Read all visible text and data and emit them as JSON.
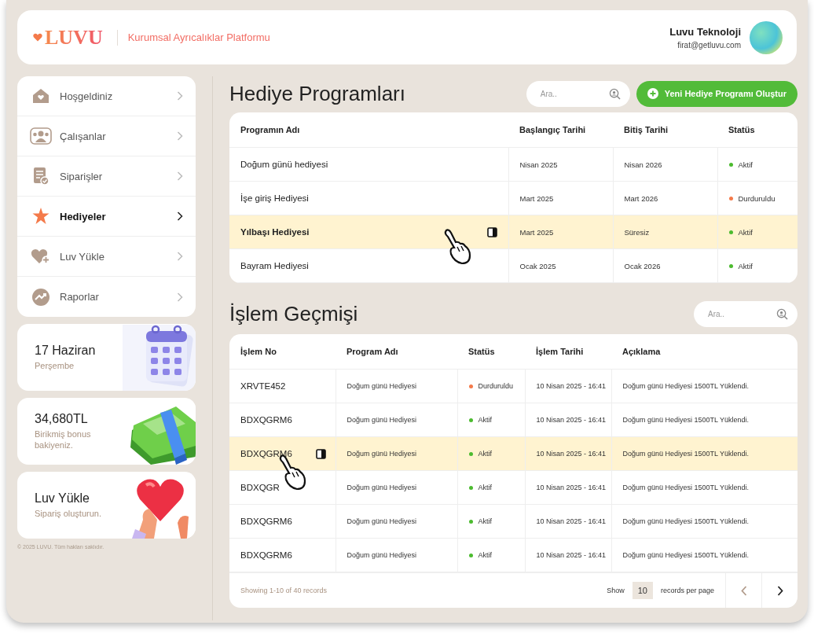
{
  "header": {
    "logo": "LUVU",
    "tagline": "Kurumsal Ayrıcalıklar Platformu",
    "company": "Luvu Teknoloji",
    "email": "firat@getluvu.com"
  },
  "sidebar": {
    "items": [
      {
        "label": "Hoşgeldiniz",
        "selected": false
      },
      {
        "label": "Çalışanlar",
        "selected": false
      },
      {
        "label": "Siparişler",
        "selected": false
      },
      {
        "label": "Hediyeler",
        "selected": true
      },
      {
        "label": "Luv Yükle",
        "selected": false
      },
      {
        "label": "Raporlar",
        "selected": false
      }
    ]
  },
  "cards": [
    {
      "kind": "calendar",
      "title": "17 Haziran",
      "subtitle": "Perşembe"
    },
    {
      "kind": "money",
      "title": "34,680TL",
      "subtitle": "Birikmiş bonus bakiyeniz."
    },
    {
      "kind": "heart",
      "title": "Luv Yükle",
      "subtitle": "Sipariş oluşturun."
    }
  ],
  "footer": "© 2025 LUVU. Tüm hakları saklıdır.",
  "programs": {
    "title": "Hediye Programları",
    "search": {
      "placeholder": "Ara.."
    },
    "create_button": "Yeni Hediye Programı Oluştur",
    "columns": [
      "Programın Adı",
      "Başlangıç Tarihi",
      "Bitiş Tarihi",
      "Statüs"
    ],
    "rows": [
      {
        "selected": false,
        "cells": [
          {
            "text": "Doğum günü hediyesi"
          },
          {
            "text": "Nisan 2025"
          },
          {
            "text": "Nisan 2026"
          },
          {
            "text": "Aktif",
            "color": "#4cbb2f"
          }
        ]
      },
      {
        "selected": false,
        "cells": [
          {
            "text": "İşe giriş Hediyesi"
          },
          {
            "text": "Mart 2025"
          },
          {
            "text": "Mart 2026"
          },
          {
            "text": "Durduruldu",
            "color": "#f47a4a"
          }
        ]
      },
      {
        "selected": true,
        "cells": [
          {
            "text": "Yılbaşı Hediyesi"
          },
          {
            "text": "Mart 2025"
          },
          {
            "text": "Süresiz"
          },
          {
            "text": "Aktif",
            "color": "#4cbb2f"
          }
        ]
      },
      {
        "selected": false,
        "cells": [
          {
            "text": "Bayram Hediyesi"
          },
          {
            "text": "Ocak 2025"
          },
          {
            "text": "Ocak 2026"
          },
          {
            "text": "Aktif",
            "color": "#4cbb2f"
          }
        ]
      }
    ]
  },
  "history": {
    "title": "İşlem Geçmişi",
    "search": {
      "placeholder": "Ara.."
    },
    "columns": [
      "İşlem No",
      "Program Adı",
      "Statüs",
      "İşlem Tarihi",
      "Açıklama"
    ],
    "rows": [
      {
        "selected": false,
        "cells": [
          {
            "text": "XRVTE452"
          },
          {
            "text": "Doğum günü Hediyesi"
          },
          {
            "text": "Durduruldu",
            "color": "#f47a4a"
          },
          {
            "text": "10 Nisan 2025 - 16:41"
          },
          {
            "text": "Doğum günü Hediyesi 1500TL Yüklendi."
          }
        ]
      },
      {
        "selected": false,
        "cells": [
          {
            "text": "BDXQGRM6"
          },
          {
            "text": "Doğum günü Hediyesi"
          },
          {
            "text": "Aktif",
            "color": "#4cbb2f"
          },
          {
            "text": "10 Nisan 2025 - 16:41"
          },
          {
            "text": "Doğum günü Hediyesi 1500TL Yüklendi."
          }
        ]
      },
      {
        "selected": true,
        "cells": [
          {
            "text": "BDXQGRM6"
          },
          {
            "text": "Doğum günü Hediyesi"
          },
          {
            "text": "Aktif",
            "color": "#4cbb2f"
          },
          {
            "text": "10 Nisan 2025 - 16:41"
          },
          {
            "text": "Doğum günü Hediyesi 1500TL Yüklendi."
          }
        ]
      },
      {
        "selected": false,
        "cells": [
          {
            "text": "BDXQGR"
          },
          {
            "text": "Doğum günü Hediyesi"
          },
          {
            "text": "Aktif",
            "color": "#4cbb2f"
          },
          {
            "text": "10 Nisan 2025 - 16:41"
          },
          {
            "text": "Doğum günü Hediyesi 1500TL Yüklendi."
          }
        ]
      },
      {
        "selected": false,
        "cells": [
          {
            "text": "BDXQGRM6"
          },
          {
            "text": "Doğum günü Hediyesi"
          },
          {
            "text": "Aktif",
            "color": "#4cbb2f"
          },
          {
            "text": "10 Nisan 2025 - 16:41"
          },
          {
            "text": "Doğum günü Hediyesi 1500TL Yüklendi."
          }
        ]
      },
      {
        "selected": false,
        "cells": [
          {
            "text": "BDXQGRM6"
          },
          {
            "text": "Doğum günü Hediyesi"
          },
          {
            "text": "Aktif",
            "color": "#4cbb2f"
          },
          {
            "text": "10 Nisan 2025 - 16:41"
          },
          {
            "text": "Doğum günü Hediyesi 1500TL Yüklendi."
          }
        ]
      }
    ],
    "pager": {
      "summary": "Showing 1-10 of 40 records",
      "show_label": "Show",
      "per_page": "10",
      "per_page_label": "records per page"
    }
  }
}
